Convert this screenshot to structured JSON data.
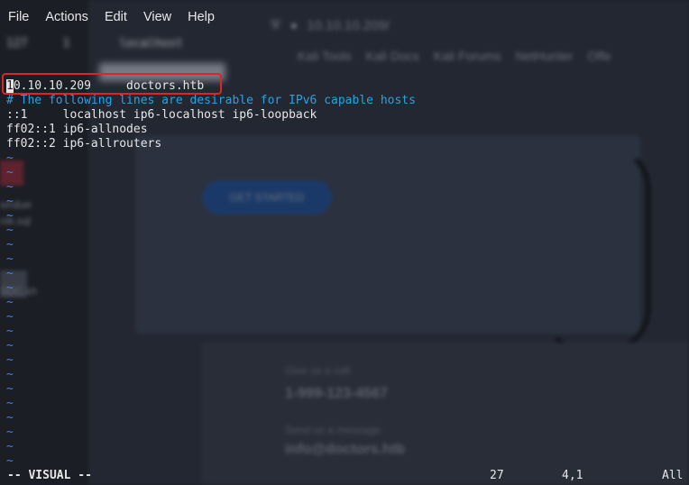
{
  "menu": [
    "File",
    "Actions",
    "Edit",
    "View",
    "Help"
  ],
  "background": {
    "url": "10.10.10.209/",
    "bookmarks": [
      "Kali Tools",
      "Kali Docs",
      "Kali Forums",
      "NetHunter",
      "Offe"
    ],
    "cta_label": "GET STARTED",
    "contact_label_1": "Give us a call",
    "phone": "1-999-123-4567",
    "contact_label_2": "Send us a message",
    "email": "info@doctors.htb",
    "desktop_labels": [
      "wn&wi",
      "nik.sql",
      "SDC.sh"
    ]
  },
  "editor": {
    "line1_partial": "127     1       localhost",
    "hosts_entry": {
      "cursor_char": "1",
      "rest": "0.10.10.209     doctors.htb"
    },
    "comment_line": "# The following lines are desirable for IPv6 capable hosts",
    "ipv6_lines": [
      "::1     localhost ip6-localhost ip6-loopback",
      "ff02::1 ip6-allnodes",
      "ff02::2 ip6-allrouters"
    ],
    "tilde": "~"
  },
  "status": {
    "mode": "-- VISUAL --",
    "count": "27",
    "position": "4,1",
    "scroll": "All"
  },
  "colors": {
    "highlight": "#e02424",
    "comment": "#2ba1e0",
    "tilde": "#4a7fd6"
  }
}
